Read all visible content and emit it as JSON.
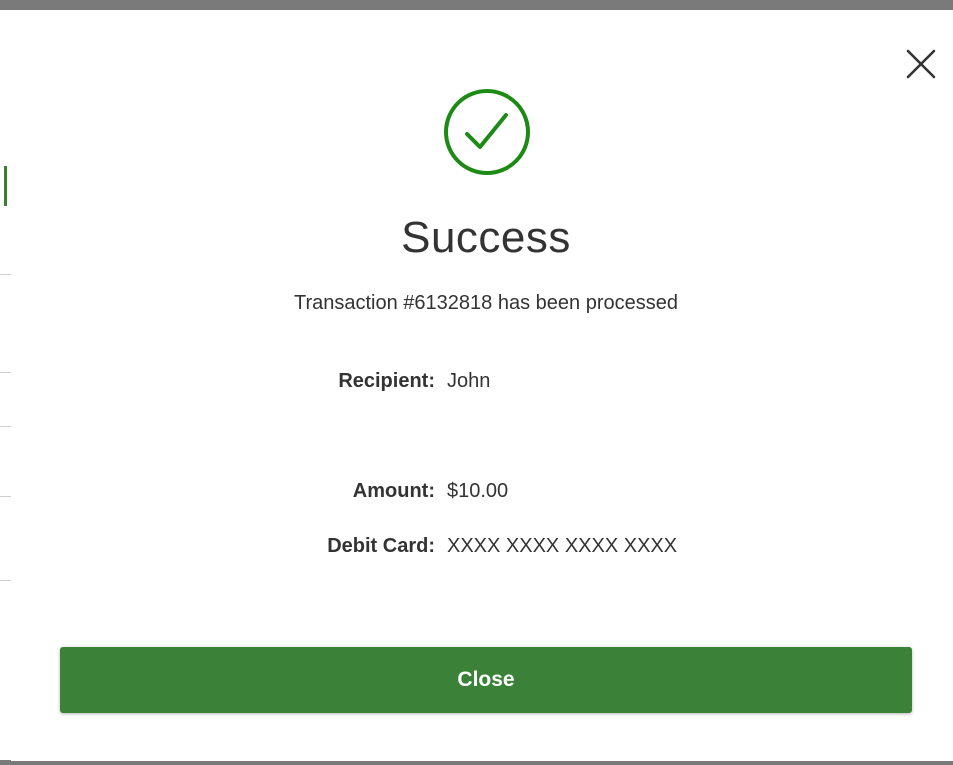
{
  "modal": {
    "title": "Success",
    "message": "Transaction #6132818 has been processed",
    "details": [
      {
        "label": "Recipient:",
        "value": "John"
      },
      {
        "label": "Amount:",
        "value": "$10.00"
      },
      {
        "label": "Debit Card:",
        "value": "XXXX XXXX XXXX XXXX"
      }
    ],
    "close_button_label": "Close",
    "close_icon": "close-icon",
    "status_icon": "check-circle-icon"
  },
  "colors": {
    "accent": "#3b8238",
    "success_icon": "#1e8a16",
    "text": "#333333",
    "backdrop": "#7a7a7a"
  }
}
